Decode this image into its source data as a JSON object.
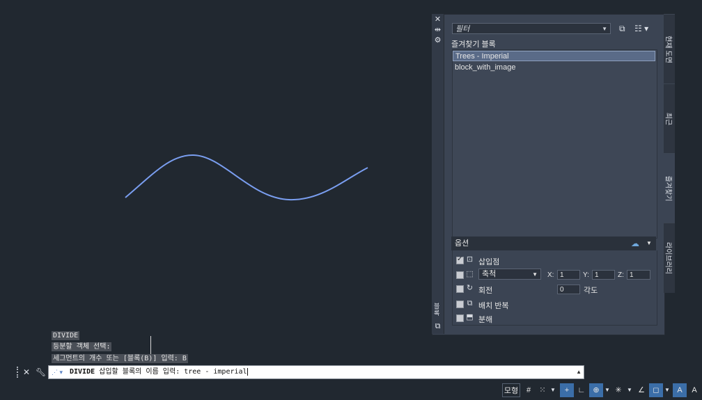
{
  "app": {
    "accent": "#4f8fd8",
    "background": "#212830",
    "curve_color": "#7a9ef0"
  },
  "palette": {
    "strip_icons": [
      "close-icon",
      "auto-hide-icon",
      "properties-icon"
    ],
    "strip_label": "블록",
    "filter": {
      "value": "필터"
    },
    "favorites_title": "즐겨찾기 블록",
    "blocks": [
      {
        "name": "Trees - Imperial",
        "selected": true
      },
      {
        "name": "block_with_image",
        "selected": false
      }
    ],
    "options": {
      "title": "옵션",
      "insertion_point": {
        "label": "삽입점",
        "checked": true
      },
      "scale": {
        "value": "축척",
        "checked": false,
        "x_label": "X:",
        "x": "1",
        "y_label": "Y:",
        "y": "1",
        "z_label": "Z:",
        "z": "1"
      },
      "rotation": {
        "label": "회전",
        "checked": false,
        "angle_value": "0",
        "angle_label": "각도"
      },
      "repeat": {
        "label": "배치 반복",
        "checked": false
      },
      "explode": {
        "label": "분해",
        "checked": false
      }
    },
    "side_tabs": [
      "현재 도면",
      "최근",
      "즐겨찾기",
      "라이브러리"
    ]
  },
  "command": {
    "history": [
      "DIVIDE",
      "등분할 객체 선택:",
      "세그먼트의 개수 또는 [블록(B)] 입력: B"
    ],
    "prompt_command": "DIVIDE",
    "prompt_text": " 삽입할 블록의 이름 입력: tree - imperial"
  },
  "status_bar": {
    "model_label": "모형"
  }
}
